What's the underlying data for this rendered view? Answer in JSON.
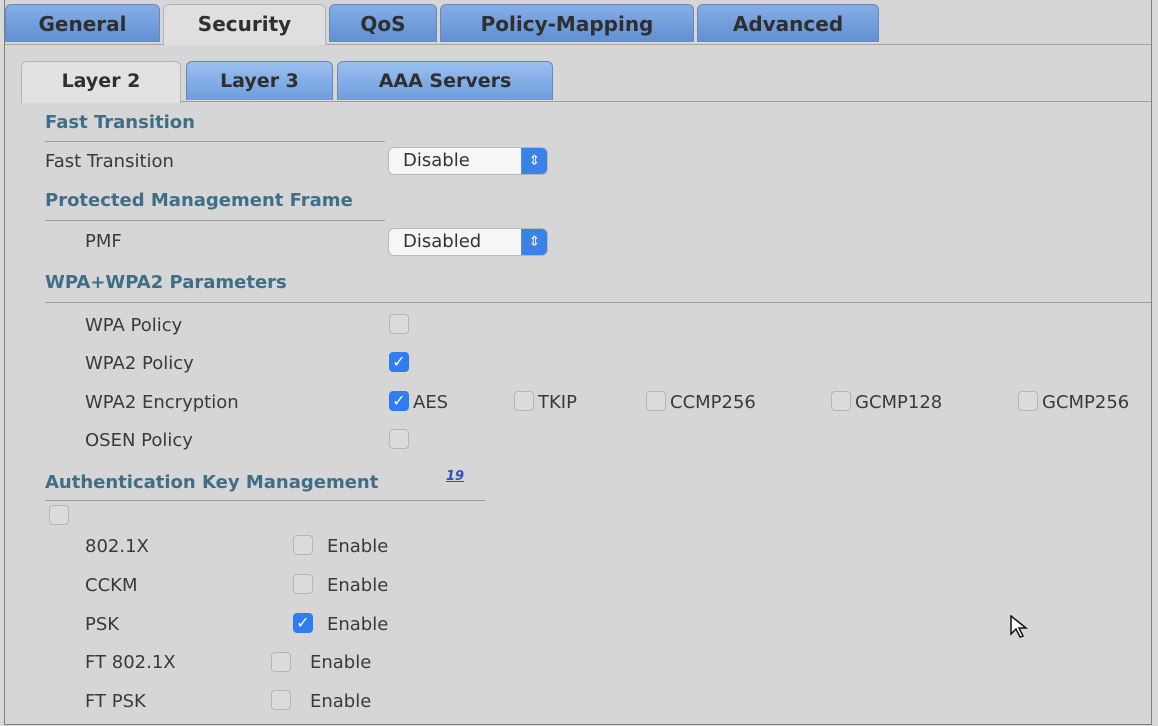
{
  "tabs": [
    "General",
    "Security",
    "QoS",
    "Policy-Mapping",
    "Advanced"
  ],
  "subtabs": [
    "Layer 2",
    "Layer 3",
    "AAA Servers"
  ],
  "fast_transition": {
    "section_title": "Fast Transition",
    "label": "Fast Transition",
    "value": "Disable"
  },
  "pmf": {
    "section_title": "Protected Management Frame",
    "label": "PMF",
    "value": "Disabled"
  },
  "wpa": {
    "section_title": "WPA+WPA2 Parameters",
    "wpa_policy": "WPA Policy",
    "wpa2_policy": "WPA2 Policy",
    "wpa2_encryption": "WPA2 Encryption",
    "osen_policy": "OSEN Policy",
    "enc_options": [
      "AES",
      "TKIP",
      "CCMP256",
      "GCMP128",
      "GCMP256"
    ]
  },
  "akm": {
    "section_title": "Authentication Key Management",
    "help": "19",
    "items": [
      {
        "label": "802.1X",
        "enable": "Enable"
      },
      {
        "label": "CCKM",
        "enable": "Enable"
      },
      {
        "label": "PSK",
        "enable": "Enable"
      },
      {
        "label": "FT 802.1X",
        "enable": "Enable"
      },
      {
        "label": "FT PSK",
        "enable": "Enable"
      }
    ]
  }
}
